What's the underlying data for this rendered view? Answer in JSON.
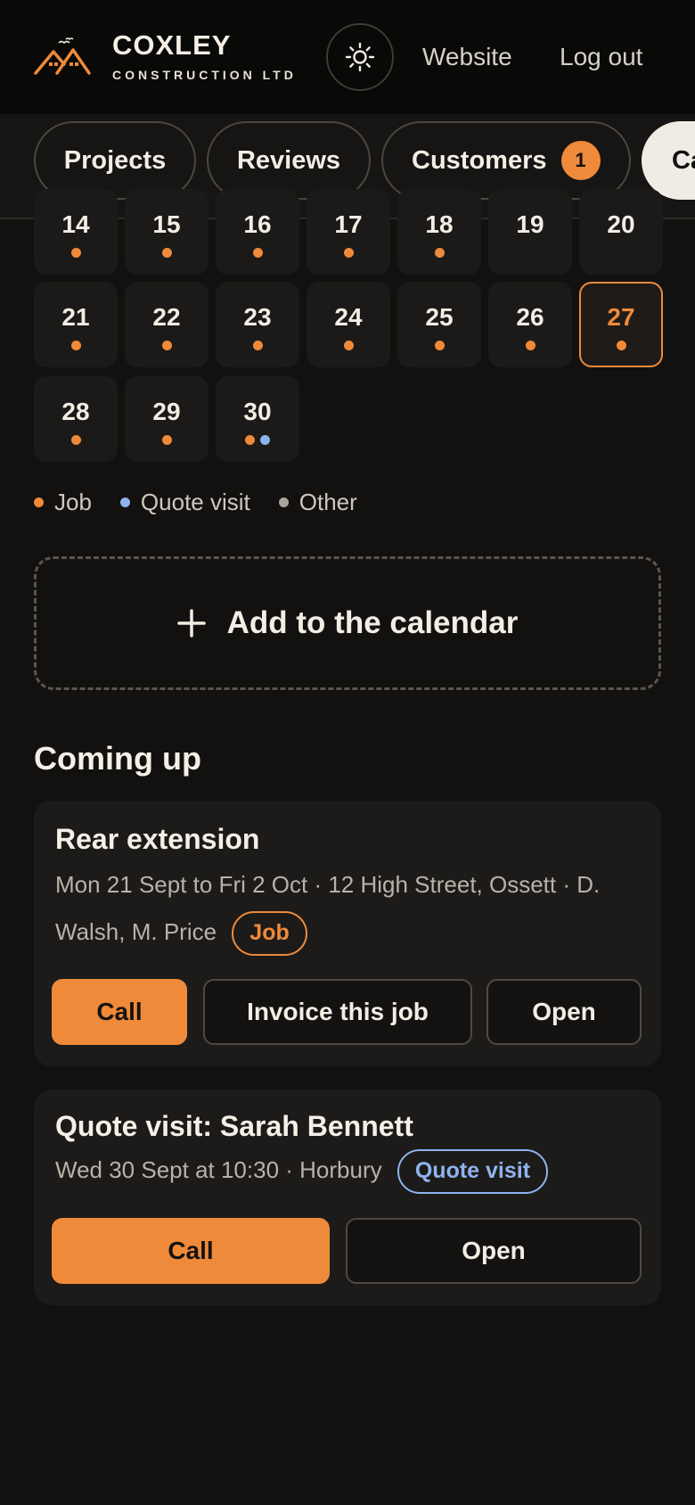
{
  "header": {
    "brand_name": "COXLEY",
    "brand_sub": "CONSTRUCTION LTD",
    "links": {
      "website": "Website",
      "logout": "Log out"
    },
    "theme_icon": "sun-icon"
  },
  "nav": {
    "items": [
      {
        "label": "Projects"
      },
      {
        "label": "Reviews"
      },
      {
        "label": "Customers",
        "badge": "1"
      },
      {
        "label": "Ca"
      }
    ]
  },
  "calendar": {
    "rows": [
      [
        {
          "day": "14",
          "dots": [
            "job"
          ]
        },
        {
          "day": "15",
          "dots": [
            "job"
          ]
        },
        {
          "day": "16",
          "dots": [
            "job"
          ]
        },
        {
          "day": "17",
          "dots": [
            "job"
          ]
        },
        {
          "day": "18",
          "dots": [
            "job"
          ]
        },
        {
          "day": "19",
          "dots": []
        },
        {
          "day": "20",
          "dots": []
        }
      ],
      [
        {
          "day": "21",
          "dots": [
            "job"
          ]
        },
        {
          "day": "22",
          "dots": [
            "job"
          ]
        },
        {
          "day": "23",
          "dots": [
            "job"
          ]
        },
        {
          "day": "24",
          "dots": [
            "job"
          ]
        },
        {
          "day": "25",
          "dots": [
            "job"
          ]
        },
        {
          "day": "26",
          "dots": [
            "job"
          ]
        },
        {
          "day": "27",
          "dots": [
            "job"
          ],
          "today": true
        }
      ],
      [
        {
          "day": "28",
          "dots": [
            "job"
          ]
        },
        {
          "day": "29",
          "dots": [
            "job"
          ]
        },
        {
          "day": "30",
          "dots": [
            "job",
            "quote"
          ]
        }
      ]
    ],
    "legend": [
      {
        "kind": "job",
        "label": "Job"
      },
      {
        "kind": "quote",
        "label": "Quote visit"
      },
      {
        "kind": "other",
        "label": "Other"
      }
    ],
    "add_label": "Add to the calendar"
  },
  "coming_up": {
    "title": "Coming up",
    "cards": [
      {
        "title": "Rear extension",
        "meta": "Mon 21 Sept to Fri 2 Oct · 12 High Street, Ossett · D. Walsh, M. Price",
        "tag": "Job",
        "buttons": [
          "Call",
          "Invoice this job",
          "Open"
        ]
      },
      {
        "title": "Quote visit: Sarah Bennett",
        "meta": "Wed 30 Sept at 10:30 · Horbury",
        "tag": "Quote visit",
        "buttons": [
          "Call",
          "Open"
        ]
      }
    ]
  },
  "colors": {
    "accent": "#ef8a3a",
    "quote": "#8fb3ef",
    "other": "#a9a39a",
    "background": "#121110"
  }
}
